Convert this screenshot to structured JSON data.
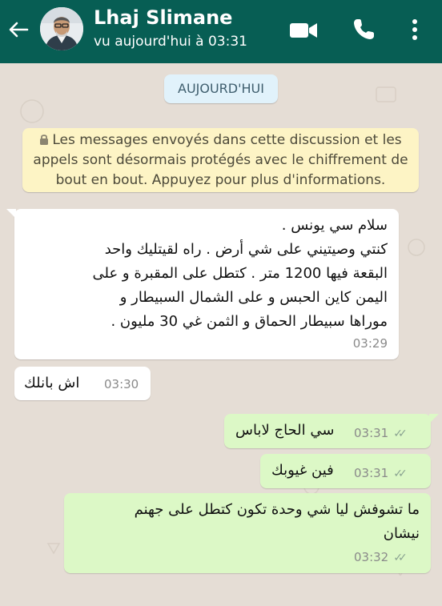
{
  "header": {
    "contact_name": "Lhaj Slimane",
    "status": "vu aujourd'hui à 03:31",
    "icons": [
      "back-arrow-icon",
      "video-call-icon",
      "phone-icon",
      "more-vert-icon"
    ],
    "bg_color": "#075e54"
  },
  "chat": {
    "date_chip": "AUJOURD'HUI",
    "encryption_notice": "Les messages envoyés dans cette discussion et les appels sont désormais protégés avec le chiffrement de bout en bout. Appuyez pour plus d'informations.",
    "messages": [
      {
        "direction": "incoming",
        "lines": [
          "سلام سي يونس .",
          "كنتي وصيتيني على شي أرض . راه لقيتليك واحد",
          "البقعة فيها 1200 متر . كتطل على المقبرة و على",
          "اليمن كاين الحبس و على الشمال السبيطار و",
          "موراها سبيطار الحماق و الثمن غي 30 مليون ."
        ],
        "time": "03:29"
      },
      {
        "direction": "incoming",
        "lines": [
          "اش بانلك"
        ],
        "time": "03:30"
      },
      {
        "direction": "outgoing",
        "lines": [
          "سي الحاج لاباس"
        ],
        "time": "03:31"
      },
      {
        "direction": "outgoing",
        "lines": [
          "فين غيوبك"
        ],
        "time": "03:31"
      },
      {
        "direction": "outgoing",
        "lines": [
          "ما تشوفش ليا شي وحدة تكون كتطل على جهنم",
          "نيشان"
        ],
        "time": "03:32"
      }
    ]
  },
  "colors": {
    "incoming_bubble": "#ffffff",
    "outgoing_bubble": "#dcf8c6",
    "notice_bg": "#fdf4c5",
    "date_chip_bg": "#e1f2fb",
    "chat_bg": "#e5ddd5"
  }
}
